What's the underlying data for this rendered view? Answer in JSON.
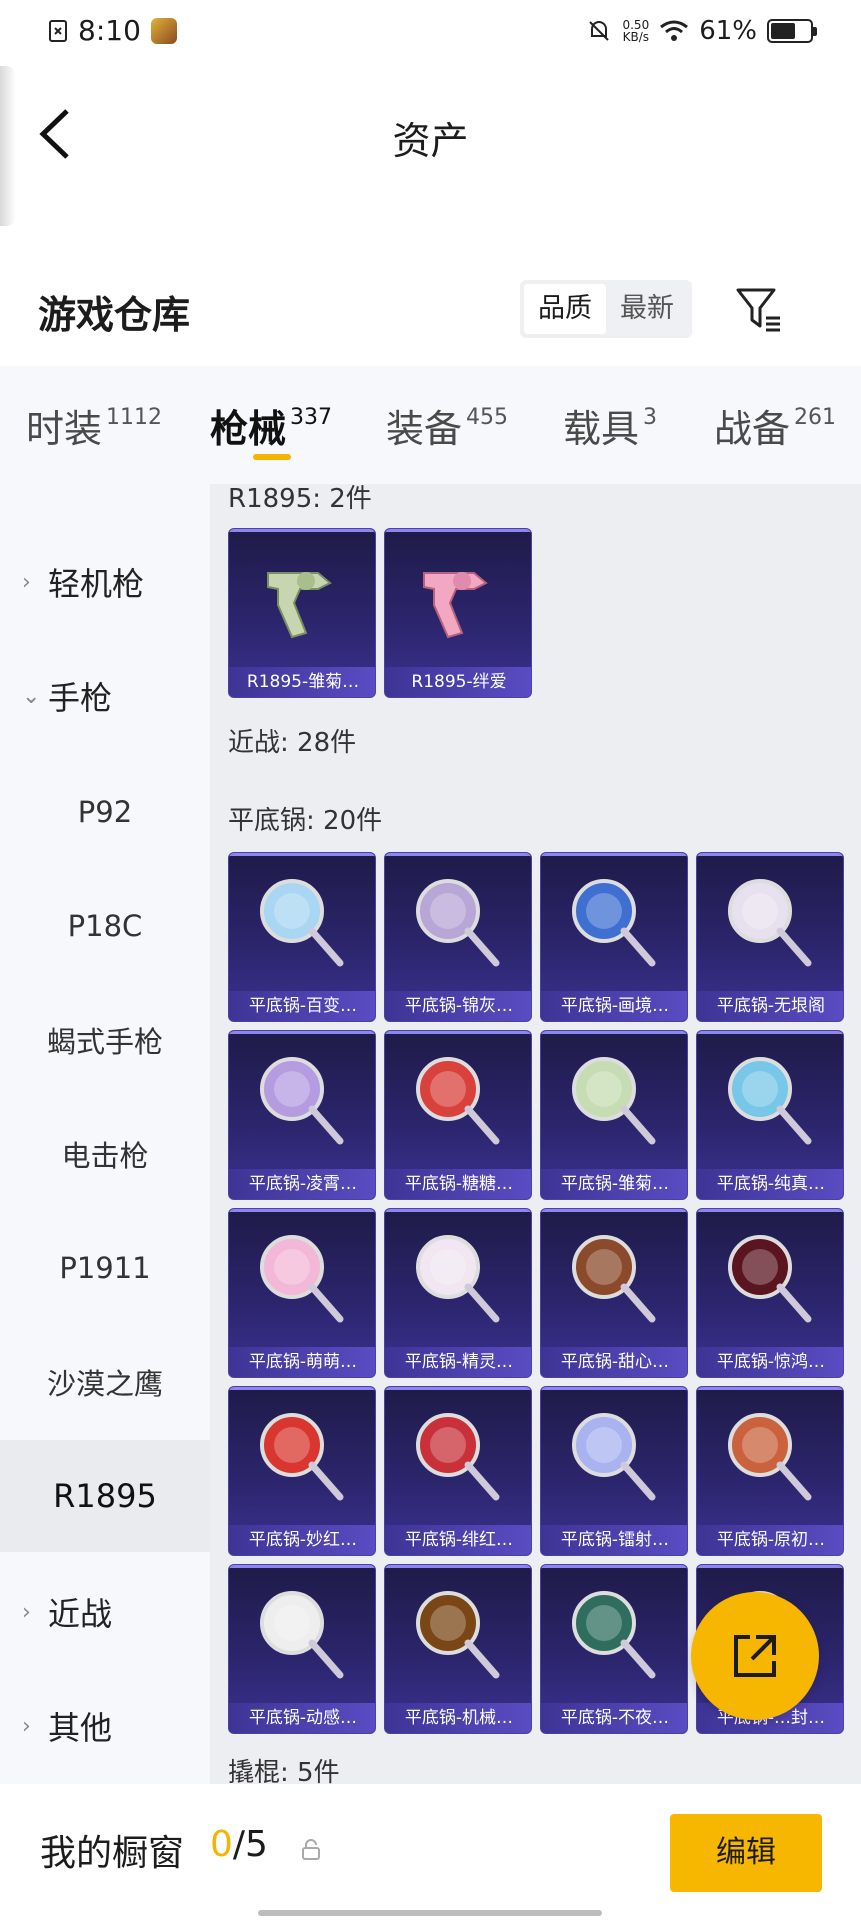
{
  "status_bar": {
    "time": "8:10",
    "net_speed_value": "0.50",
    "net_speed_unit": "KB/s",
    "battery": "61%"
  },
  "header": {
    "title": "资产"
  },
  "warehouse": {
    "title": "游戏仓库",
    "sort_options": [
      "品质",
      "最新"
    ],
    "active_sort": "品质"
  },
  "tabs": [
    {
      "label": "时装",
      "count": "1112"
    },
    {
      "label": "枪械",
      "count": "337",
      "active": true
    },
    {
      "label": "装备",
      "count": "455"
    },
    {
      "label": "载具",
      "count": "3"
    },
    {
      "label": "战备",
      "count": "261"
    }
  ],
  "sidebar": [
    {
      "label": "轻机枪",
      "type": "group",
      "expanded": false
    },
    {
      "label": "手枪",
      "type": "group",
      "expanded": true
    },
    {
      "label": "P92",
      "type": "item"
    },
    {
      "label": "P18C",
      "type": "item"
    },
    {
      "label": "蝎式手枪",
      "type": "item"
    },
    {
      "label": "电击枪",
      "type": "item"
    },
    {
      "label": "P1911",
      "type": "item"
    },
    {
      "label": "沙漠之鹰",
      "type": "item"
    },
    {
      "label": "R1895",
      "type": "item",
      "selected": true
    },
    {
      "label": "近战",
      "type": "group",
      "expanded": false
    },
    {
      "label": "其他",
      "type": "group",
      "expanded": false
    }
  ],
  "content": {
    "groups": {
      "r1895_label": "R1895: 2件",
      "melee_label": "近战: 28件",
      "pan_label": "平底锅: 20件",
      "crowbar_label": "撬棍: 5件"
    },
    "r1895_items": [
      "R1895-雏菊…",
      "R1895-绊爱"
    ],
    "pan_items": [
      "平底锅-百变…",
      "平底锅-锦灰…",
      "平底锅-画境…",
      "平底锅-无垠阁",
      "平底锅-凌霄…",
      "平底锅-糖糖…",
      "平底锅-雏菊…",
      "平底锅-纯真…",
      "平底锅-萌萌…",
      "平底锅-精灵…",
      "平底锅-甜心…",
      "平底锅-惊鸿…",
      "平底锅-妙红…",
      "平底锅-绯红…",
      "平底锅-镭射…",
      "平底锅-原初…",
      "平底锅-动感…",
      "平底锅-机械…",
      "平底锅-不夜…",
      "平底锅-…封…"
    ]
  },
  "bottom_bar": {
    "label": "我的橱窗",
    "current": "0",
    "total": "/5",
    "edit_label": "编辑"
  },
  "colors": {
    "accent": "#f7b700",
    "card_bg": "#2d2670",
    "card_label": "#4a3fb0"
  }
}
